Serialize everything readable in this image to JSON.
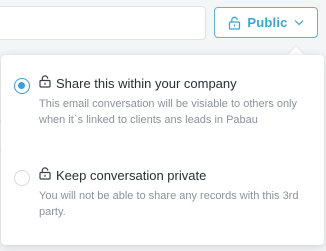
{
  "privacy_button": {
    "label": "Public",
    "accent": "#3aa5d2",
    "icon": "lock-icon",
    "dropdown_icon": "chevron-down-icon"
  },
  "options": [
    {
      "icon": "lock-icon",
      "title": "Share this within your company",
      "description": "This email conversation will be visiable to others only when it`s linked to clients ans leads in Pabau",
      "selected": true
    },
    {
      "icon": "lock-icon",
      "title": "Keep conversation private",
      "description": "You will not be able to share any records with this 3rd party.",
      "selected": false
    }
  ]
}
